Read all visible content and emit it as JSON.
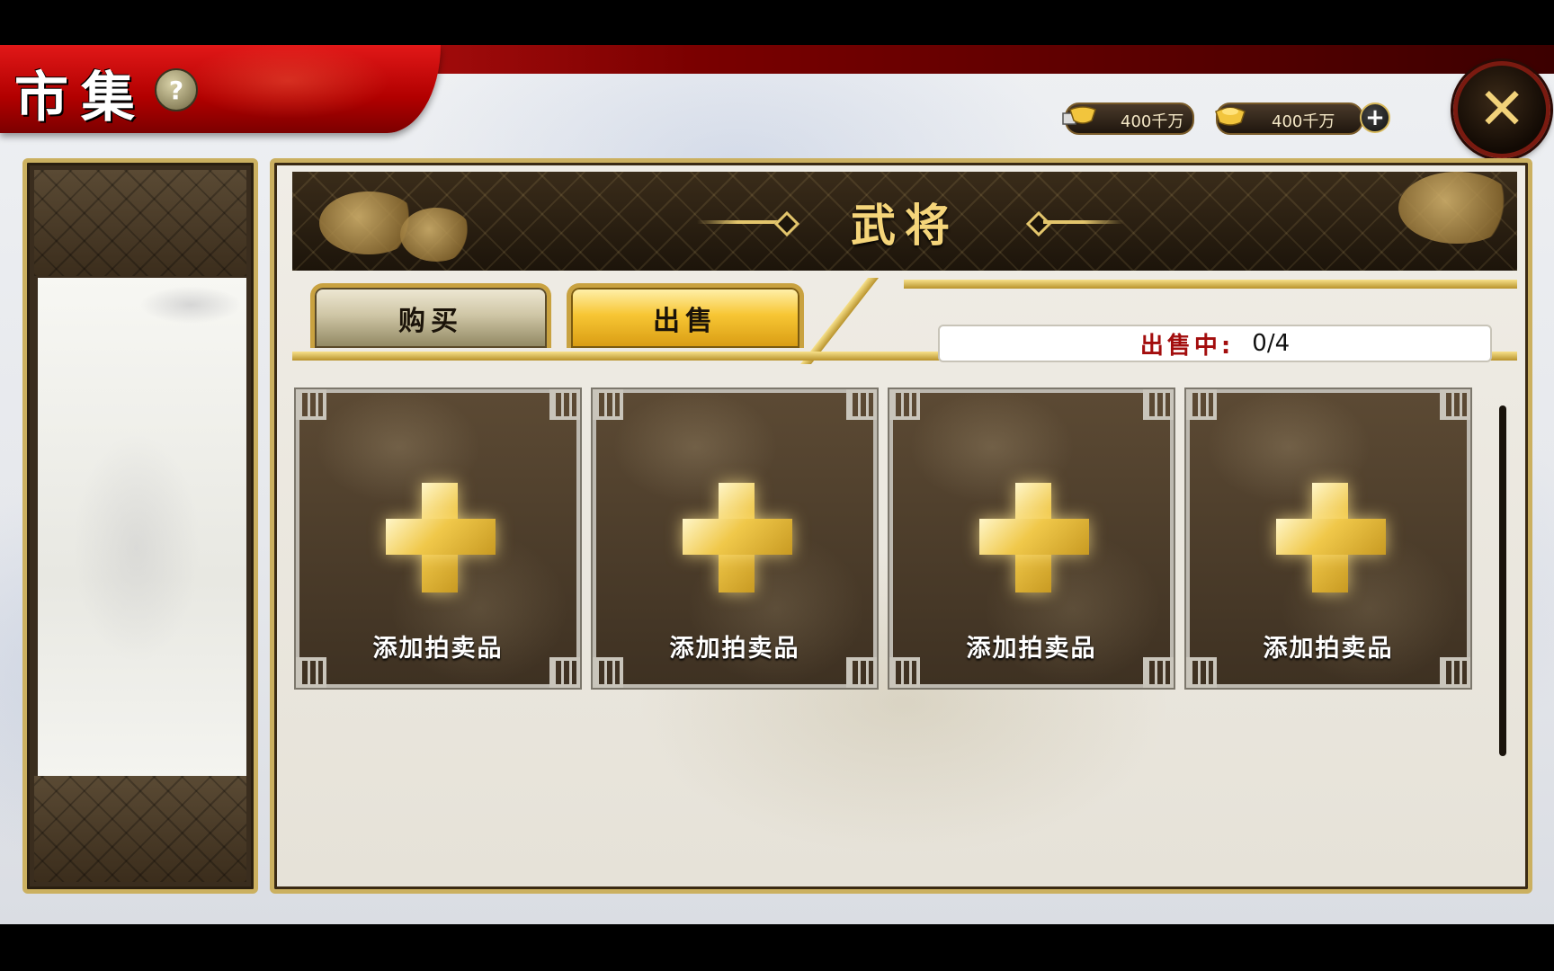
{
  "header": {
    "title": "市集",
    "help_icon": "?"
  },
  "currency": {
    "silver_amount": "400千万",
    "gold_amount": "400千万",
    "add_symbol": "+"
  },
  "close_icon_glyph": "✕",
  "panel": {
    "title": "武将",
    "tabs": [
      {
        "label": "购买",
        "active": false
      },
      {
        "label": "出售",
        "active": true
      }
    ],
    "selling_label": "出售中:",
    "selling_value": "0/4",
    "slots": [
      {
        "label": "添加拍卖品"
      },
      {
        "label": "添加拍卖品"
      },
      {
        "label": "添加拍卖品"
      },
      {
        "label": "添加拍卖品"
      }
    ]
  },
  "colors": {
    "banner_red": "#c40f0f",
    "gold_accent": "#e3c56c",
    "active_tab": "#f7c634"
  }
}
